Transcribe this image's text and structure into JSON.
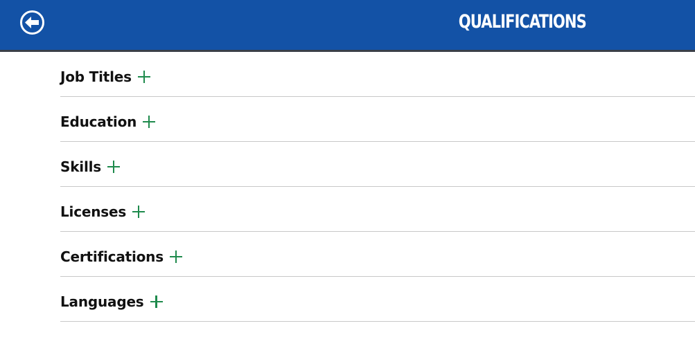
{
  "header": {
    "title": "QUALIFICATIONS",
    "back_icon": "arrow-left-circle-icon",
    "background_color": "#1352a6"
  },
  "sections": [
    {
      "label": "Job Titles",
      "icon": "plus-icon"
    },
    {
      "label": "Education",
      "icon": "plus-icon"
    },
    {
      "label": "Skills",
      "icon": "plus-icon"
    },
    {
      "label": "Licenses",
      "icon": "plus-icon"
    },
    {
      "label": "Certifications",
      "icon": "plus-icon"
    },
    {
      "label": "Languages",
      "icon": "plus-icon"
    }
  ],
  "colors": {
    "accent_plus": "#1e8a4c",
    "divider": "#c8c8c8",
    "text": "#111111"
  }
}
